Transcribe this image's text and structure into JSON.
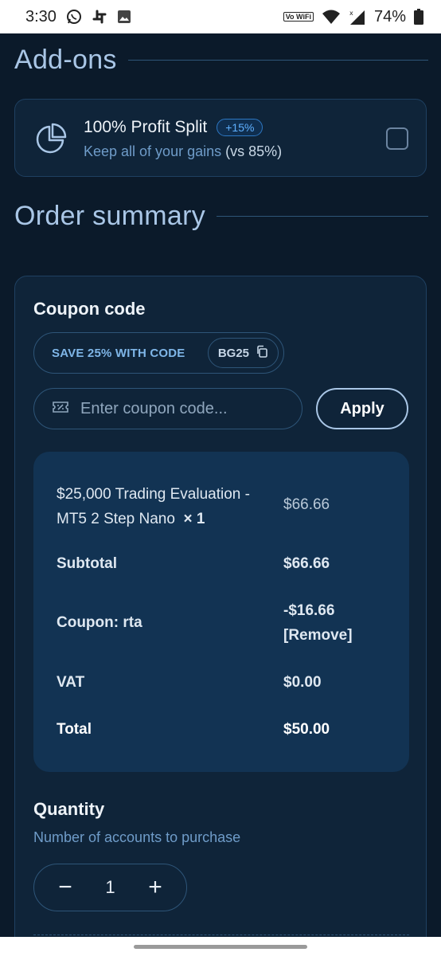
{
  "status_bar": {
    "time": "3:30",
    "volte_label": "Vo WiFi",
    "battery": "74%",
    "icons": [
      "whatsapp-icon",
      "slack-icon",
      "image-icon",
      "volte-icon",
      "wifi-icon",
      "signal-icon",
      "battery-icon"
    ]
  },
  "addons": {
    "section_title": "Add-ons",
    "item": {
      "title": "100% Profit Split",
      "badge": "+15%",
      "subtitle_main": "Keep all of your gains",
      "subtitle_tail": "(vs 85%)",
      "checked": false
    }
  },
  "order_summary": {
    "section_title": "Order summary",
    "coupon_heading": "Coupon code",
    "promo_text": "SAVE 25% WITH CODE",
    "promo_code": "BG25",
    "coupon_placeholder": "Enter coupon code...",
    "apply_label": "Apply",
    "product_line_1": "$25,000 Trading Evaluation -",
    "product_line_2": "MT5 2 Step Nano",
    "product_qty": "× 1",
    "product_price": "$66.66",
    "subtotal_label": "Subtotal",
    "subtotal_value": "$66.66",
    "coupon_label": "Coupon: rta",
    "coupon_value": "-$16.66",
    "remove_label": "[Remove]",
    "vat_label": "VAT",
    "vat_value": "$0.00",
    "total_label": "Total",
    "total_value": "$50.00",
    "quantity_heading": "Quantity",
    "quantity_sub": "Number of accounts to purchase",
    "quantity_value": "1",
    "minus_label": "−",
    "plus_label": "+"
  },
  "colors": {
    "background": "#0b1a2a",
    "card": "#0f2439",
    "accent": "#5fb0ff",
    "heading": "#a9c6e6"
  }
}
